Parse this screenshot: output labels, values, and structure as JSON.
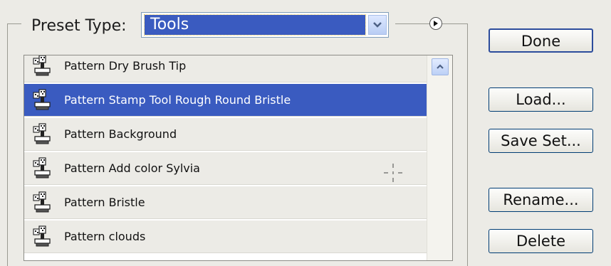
{
  "preset": {
    "label": "Preset Type:",
    "selected": "Tools"
  },
  "icons": {
    "dropdown": "chevron-down-icon",
    "menu": "flyout-menu-icon",
    "tool": "pattern-stamp-tool-icon",
    "scroll_up": "arrow-up-icon"
  },
  "list": {
    "items": [
      {
        "label": "Pattern Dry Brush Tip",
        "selected": false
      },
      {
        "label": "Pattern Stamp Tool Rough Round Bristle",
        "selected": true
      },
      {
        "label": "Pattern Background",
        "selected": false
      },
      {
        "label": "Pattern Add color Sylvia",
        "selected": false
      },
      {
        "label": "Pattern Bristle",
        "selected": false
      },
      {
        "label": "Pattern clouds",
        "selected": false
      }
    ]
  },
  "buttons": {
    "done": "Done",
    "load": "Load...",
    "save_set": "Save Set...",
    "rename": "Rename...",
    "delete": "Delete"
  },
  "colors": {
    "selection": "#3a5bc0",
    "background": "#ecebe6"
  }
}
